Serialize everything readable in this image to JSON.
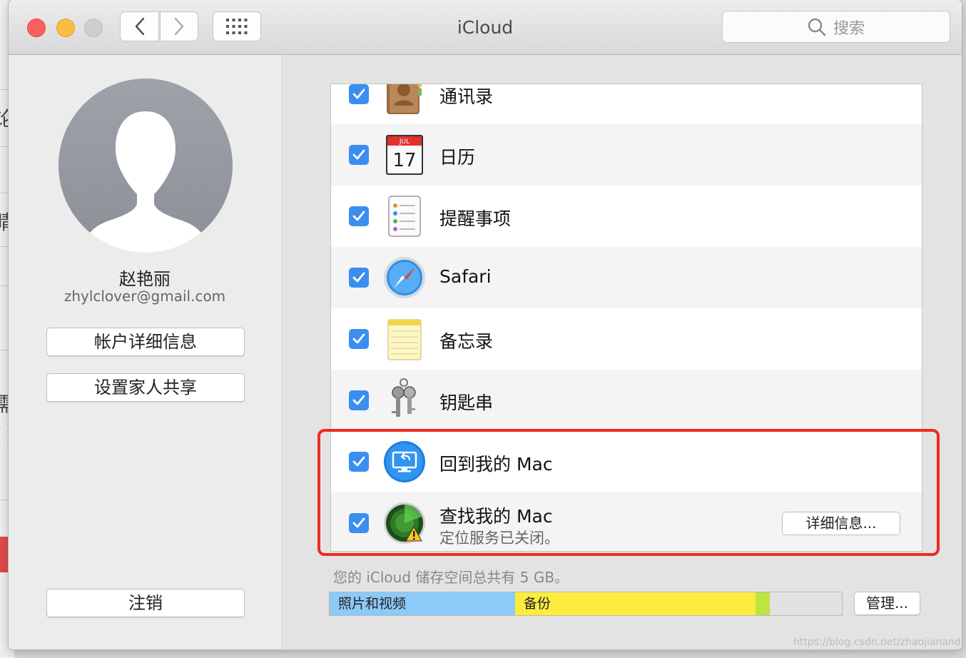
{
  "window": {
    "title": "iCloud",
    "search": {
      "placeholder": "搜索",
      "icon": "search-icon"
    }
  },
  "account": {
    "name": "赵艳丽",
    "email": "zhylclover@gmail.com",
    "buttons": {
      "details": "帐户详细信息",
      "family": "设置家人共享",
      "signout": "注销"
    }
  },
  "services": [
    {
      "label": "通讯录",
      "checked": true,
      "icon": "contacts-icon"
    },
    {
      "label": "日历",
      "checked": true,
      "icon": "calendar-icon",
      "icon_month": "JUL",
      "icon_day": "17"
    },
    {
      "label": "提醒事项",
      "checked": true,
      "icon": "reminders-icon"
    },
    {
      "label": "Safari",
      "checked": true,
      "icon": "safari-icon"
    },
    {
      "label": "备忘录",
      "checked": true,
      "icon": "notes-icon"
    },
    {
      "label": "钥匙串",
      "checked": true,
      "icon": "keychain-icon"
    },
    {
      "label": "回到我的 Mac",
      "checked": true,
      "icon": "back-to-my-mac-icon"
    },
    {
      "label": "查找我的 Mac",
      "sublabel": "定位服务已关闭。",
      "checked": true,
      "icon": "find-my-mac-icon",
      "button": "详细信息..."
    }
  ],
  "storage": {
    "text": "您的 iCloud 储存空间总共有 5 GB。",
    "segments": [
      {
        "label": "照片和视频",
        "fraction": 0.362,
        "color": "#8ccaf7"
      },
      {
        "label": "备份",
        "fraction": 0.47,
        "color": "#fbec3e"
      },
      {
        "label": "",
        "fraction": 0.027,
        "color": "#bde43f"
      }
    ],
    "manage": "管理..."
  },
  "colors": {
    "highlight": "#ee2a1e",
    "checkbox": "#3a8ef0"
  },
  "watermark": "https://blog.csdn.net/zhaojianand"
}
